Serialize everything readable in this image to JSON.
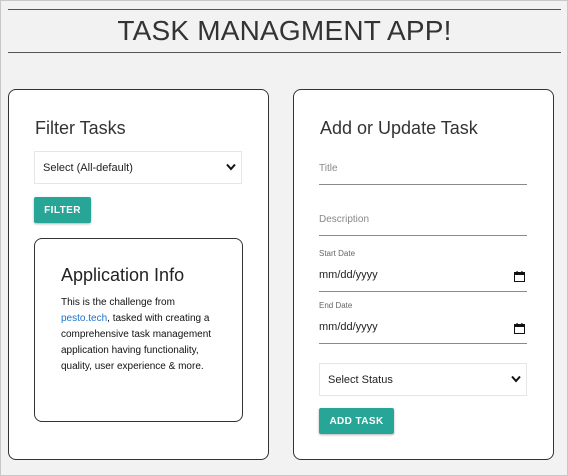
{
  "app": {
    "title": "TASK MANAGMENT APP!"
  },
  "filter": {
    "title": "Filter Tasks",
    "select_value": "Select (All-default)",
    "button_label": "FILTER"
  },
  "info": {
    "title": "Application Info",
    "text_before": "This is the challenge from ",
    "link_text": "pesto.tech",
    "text_after": ", tasked with creating a comprehensive task management application having functionality, quality, user experience & more."
  },
  "task_form": {
    "title": "Add or Update Task",
    "title_placeholder": "Title",
    "description_placeholder": "Description",
    "start_label": "Start Date",
    "start_value": "mm/dd/yyyy",
    "end_label": "End Date",
    "end_value": "mm/dd/yyyy",
    "status_value": "Select Status",
    "button_label": "ADD TASK"
  },
  "colors": {
    "accent": "#27a596",
    "link": "#1a73c9"
  },
  "icons": {
    "select_arrow": "chevron-down-icon",
    "date_picker": "calendar-icon"
  }
}
